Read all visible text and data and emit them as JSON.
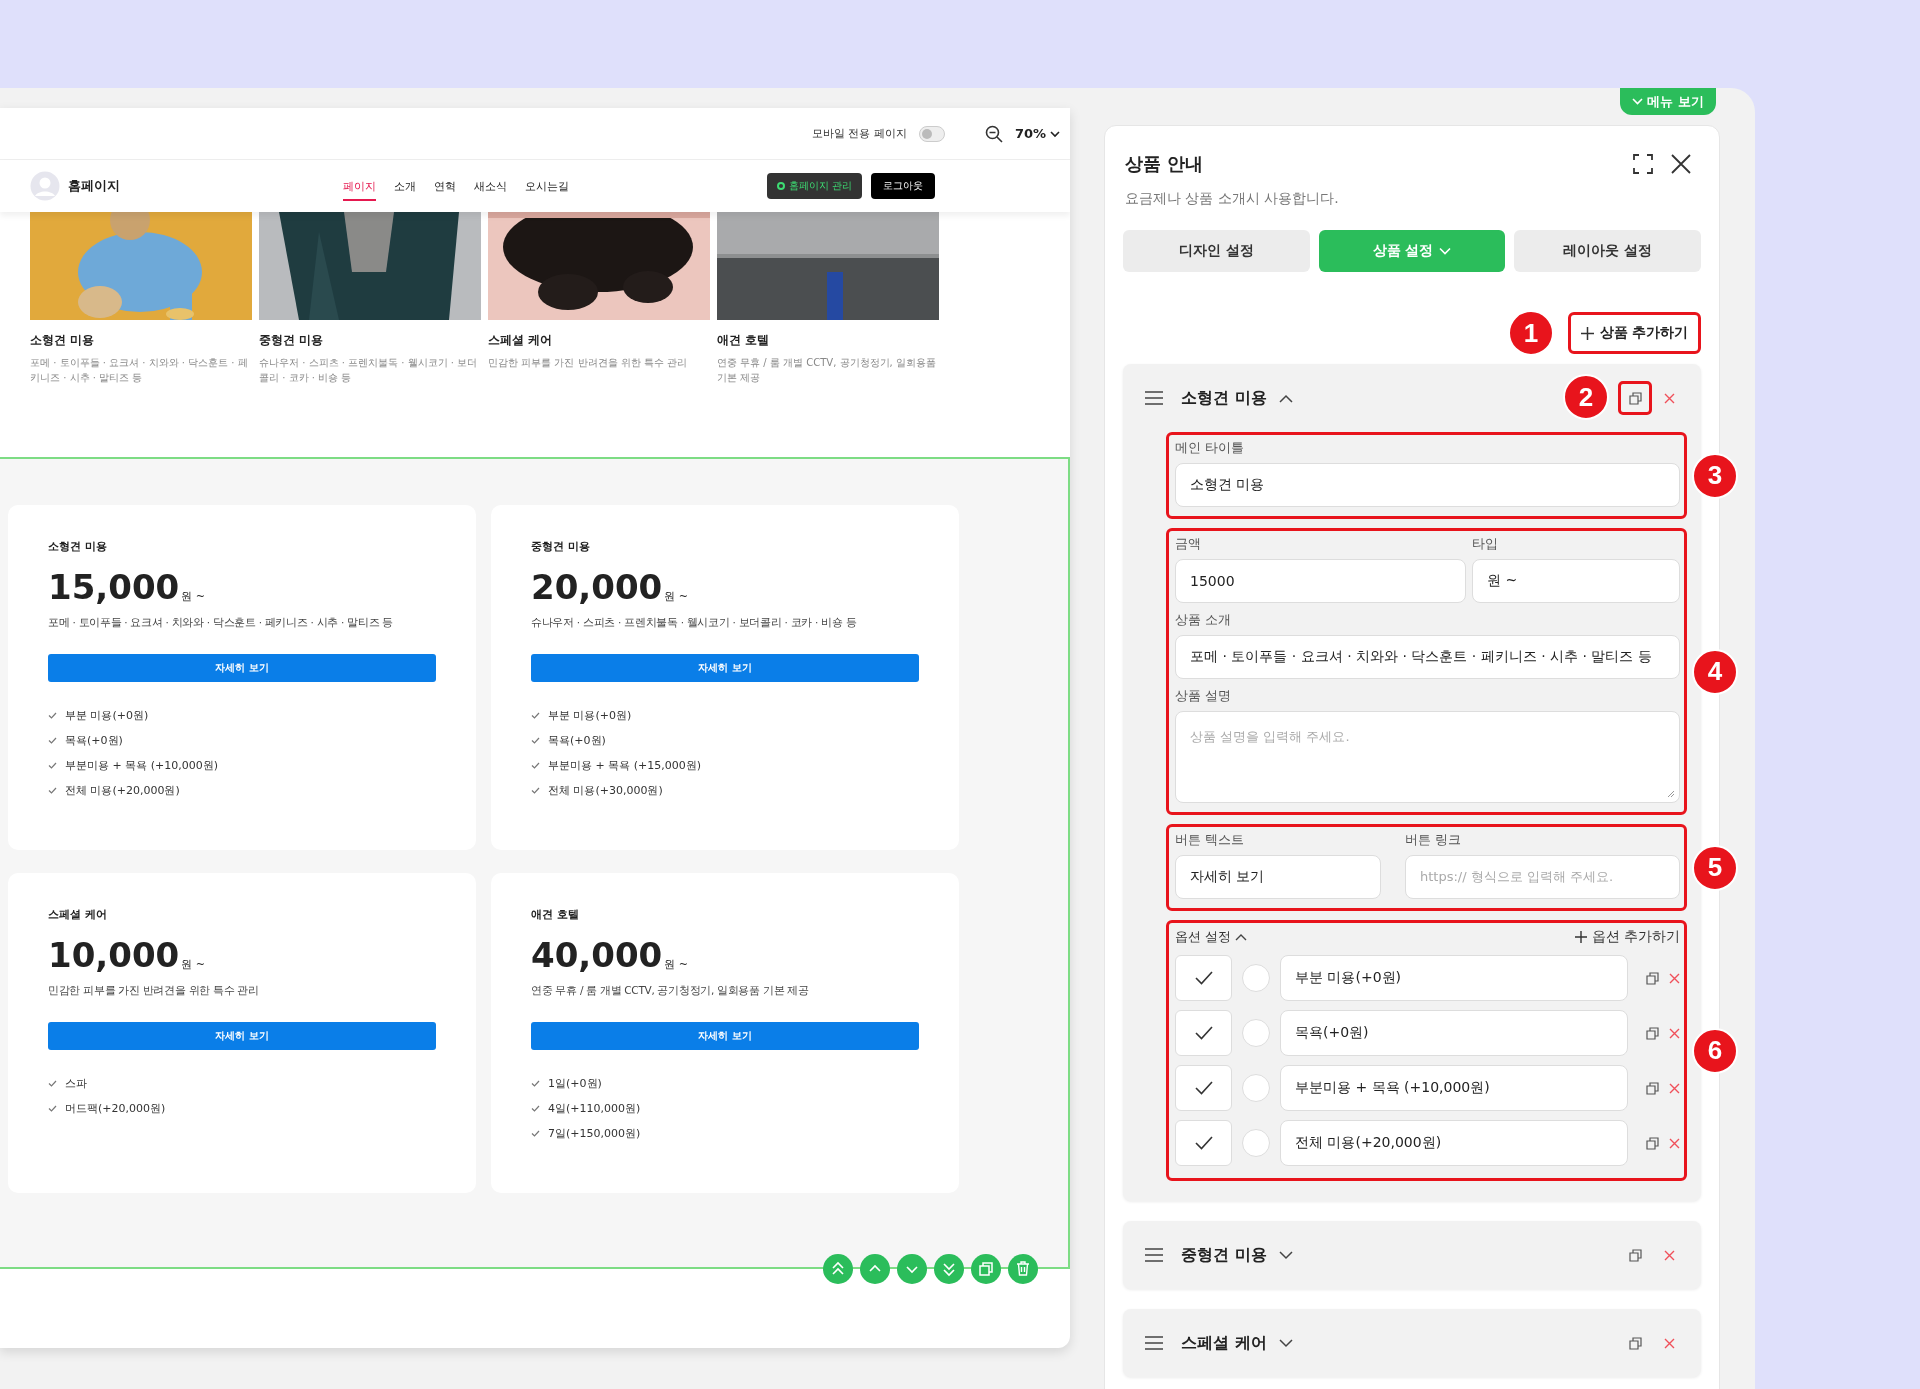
{
  "preview": {
    "mobile_toggle": {
      "label": "모바일 전용 페이지",
      "on": false
    },
    "zoom": "70%",
    "site": {
      "name": "홈페이지",
      "nav": [
        {
          "label": "페이지",
          "selected": true
        },
        {
          "label": "소개",
          "selected": false
        },
        {
          "label": "연혁",
          "selected": false
        },
        {
          "label": "새소식",
          "selected": false
        },
        {
          "label": "오시는길",
          "selected": false
        }
      ],
      "manage_button": "홈페이지 관리",
      "logout_button": "로그아웃"
    },
    "gallery": [
      {
        "title": "소형견 미용",
        "desc": "포메 · 토이푸들 · 요크셔 · 치와와 · 닥스훈트 · 페키니즈 · 시추 · 말티즈 등"
      },
      {
        "title": "중형견 미용",
        "desc": "슈나우저 · 스피츠 · 프렌치불독 · 웰시코기 · 보더콜리 · 코카 · 비숑 등"
      },
      {
        "title": "스페셜 케어",
        "desc": "민감한 피부를 가진 반려견을 위한 특수 관리"
      },
      {
        "title": "애견 호텔",
        "desc": "연중 무휴 / 룸 개별 CCTV, 공기청정기, 일회용품 기본 제공"
      }
    ],
    "products": [
      {
        "title": "소형견 미용",
        "price": "15,000",
        "unit": "원 ~",
        "desc": "포메 · 토이푸들 · 요크셔 · 치와와 · 닥스훈트 · 페키니즈 · 시추 · 말티즈 등",
        "button": "자세히 보기",
        "options": [
          "부분 미용(+0원)",
          "목욕(+0원)",
          "부분미용 + 목욕 (+10,000원)",
          "전체 미용(+20,000원)"
        ]
      },
      {
        "title": "중형견 미용",
        "price": "20,000",
        "unit": "원 ~",
        "desc": "슈나우저 · 스피츠 · 프렌치불독 · 웰시코기 · 보더콜리 · 코카 · 비숑 등",
        "button": "자세히 보기",
        "options": [
          "부분 미용(+0원)",
          "목욕(+0원)",
          "부분미용 + 목욕 (+15,000원)",
          "전체 미용(+30,000원)"
        ]
      },
      {
        "title": "스페셜 케어",
        "price": "10,000",
        "unit": "원 ~",
        "desc": "민감한 피부를 가진 반려견을 위한 특수 관리",
        "button": "자세히 보기",
        "options": [
          "스파",
          "머드팩(+20,000원)"
        ]
      },
      {
        "title": "애견 호텔",
        "price": "40,000",
        "unit": "원 ~",
        "desc": "연중 무휴 / 룸 개별 CCTV, 공기청정기, 일회용품 기본 제공",
        "button": "자세히 보기",
        "options": [
          "1일(+0원)",
          "4일(+110,000원)",
          "7일(+150,000원)"
        ]
      }
    ]
  },
  "panel": {
    "menu_button": "메뉴 보기",
    "title": "상품 안내",
    "subtitle": "요금제나 상품 소개시 사용합니다.",
    "tabs": [
      {
        "label": "디자인 설정",
        "selected": false
      },
      {
        "label": "상품 설정",
        "selected": true
      },
      {
        "label": "레이아웃 설정",
        "selected": false
      }
    ],
    "add_button": "상품 추가하기",
    "items": [
      {
        "title": "소형견 미용",
        "expanded": true
      },
      {
        "title": "중형견 미용",
        "expanded": false
      },
      {
        "title": "스페셜 케어",
        "expanded": false
      }
    ],
    "editor": {
      "main_title": {
        "label": "메인 타이틀",
        "value": "소형견 미용"
      },
      "price": {
        "label": "금액",
        "value": "15000"
      },
      "type": {
        "label": "타입",
        "value": "원 ~"
      },
      "intro": {
        "label": "상품 소개",
        "value": "포메 · 토이푸들 · 요크셔 · 치와와 · 닥스훈트 · 페키니즈 · 시추 · 말티즈 등"
      },
      "description": {
        "label": "상품 설명",
        "placeholder": "상품 설명을 입력해 주세요."
      },
      "button_text": {
        "label": "버튼 텍스트",
        "value": "자세히 보기"
      },
      "button_link": {
        "label": "버튼 링크",
        "placeholder": "https:// 형식으로 입력해 주세요."
      },
      "options_label": "옵션 설정",
      "options_expanded": true,
      "add_option": "옵션 추가하기",
      "options": [
        {
          "text": "부분 미용(+0원)",
          "checked": true,
          "selected": false
        },
        {
          "text": "목욕(+0원)",
          "checked": true,
          "selected": false
        },
        {
          "text": "부분미용 + 목욕 (+10,000원)",
          "checked": true,
          "selected": false
        },
        {
          "text": "전체 미용(+20,000원)",
          "checked": true,
          "selected": false
        }
      ]
    }
  },
  "annotations": [
    "1",
    "2",
    "3",
    "4",
    "5",
    "6"
  ]
}
